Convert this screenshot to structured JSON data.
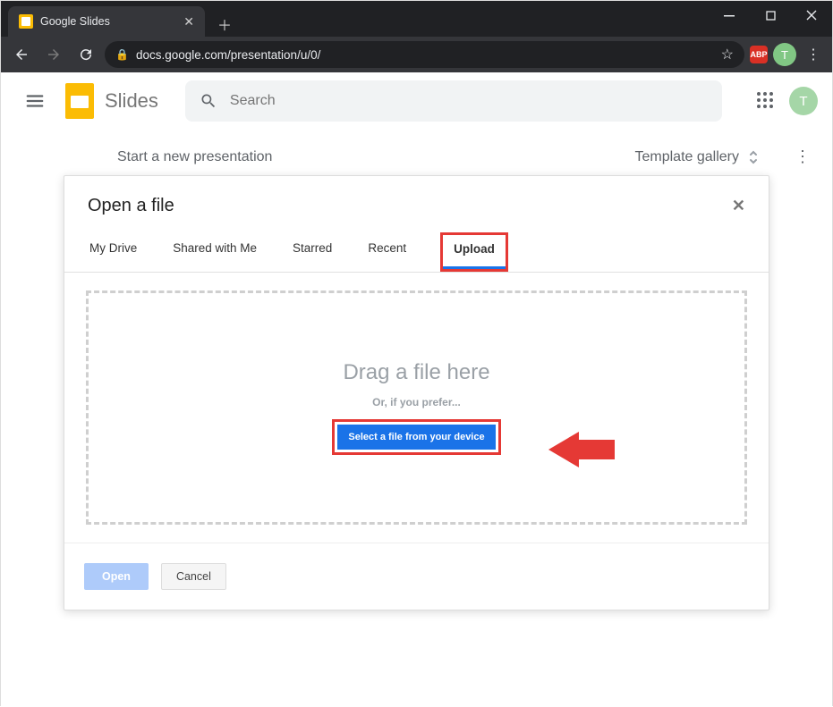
{
  "browser": {
    "tab_title": "Google Slides",
    "url": "docs.google.com/presentation/u/0/",
    "ext_badge": "ABP",
    "avatar_letter": "T"
  },
  "app": {
    "title": "Slides",
    "search_placeholder": "Search",
    "new_presentation": "Start a new presentation",
    "template_gallery": "Template gallery",
    "avatar_letter": "T"
  },
  "dialog": {
    "title": "Open a file",
    "tabs": [
      "My Drive",
      "Shared with Me",
      "Starred",
      "Recent",
      "Upload"
    ],
    "active_tab": "Upload",
    "drop_title": "Drag a file here",
    "drop_sub": "Or, if you prefer...",
    "select_button": "Select a file from your device",
    "open": "Open",
    "cancel": "Cancel"
  }
}
